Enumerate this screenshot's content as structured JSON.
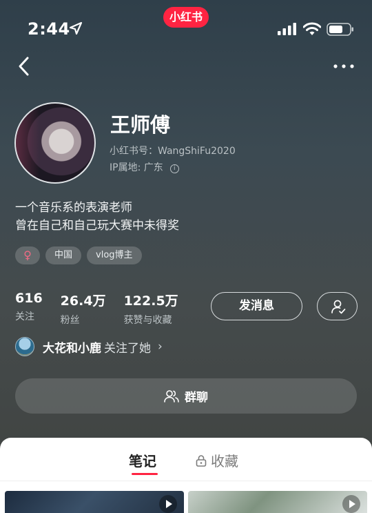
{
  "status_bar": {
    "time": "2:44",
    "app_badge": "小红书"
  },
  "profile": {
    "name": "王师傅",
    "red_id": "小红书号：WangShiFu2020",
    "ip_location": "IP属地: 广东",
    "bio_line1": "一个音乐系的表演老师",
    "bio_line2": "曾在自己和自己玩大赛中未得奖",
    "gender_symbol": "♀",
    "tags": [
      "中国",
      "vlog博主"
    ]
  },
  "stats": [
    {
      "value": "616",
      "label": "关注"
    },
    {
      "value": "26.4万",
      "label": "粉丝"
    },
    {
      "value": "122.5万",
      "label": "获赞与收藏"
    }
  ],
  "actions": {
    "message_label": "发消息"
  },
  "mutual_follow": {
    "name": "大花和小鹿",
    "text": "关注了她",
    "chevron": "›"
  },
  "group_chat": {
    "label": "群聊"
  },
  "tabs": {
    "notes": "笔记",
    "collections": "收藏"
  },
  "colors": {
    "accent": "#ff2442",
    "gender": "#f06a84"
  },
  "icons": [
    "location-arrow-icon",
    "signal-icon",
    "wifi-icon",
    "battery-icon",
    "back-chevron-icon",
    "more-dots-icon",
    "info-icon",
    "user-check-icon",
    "group-icon",
    "lock-icon",
    "play-icon"
  ]
}
